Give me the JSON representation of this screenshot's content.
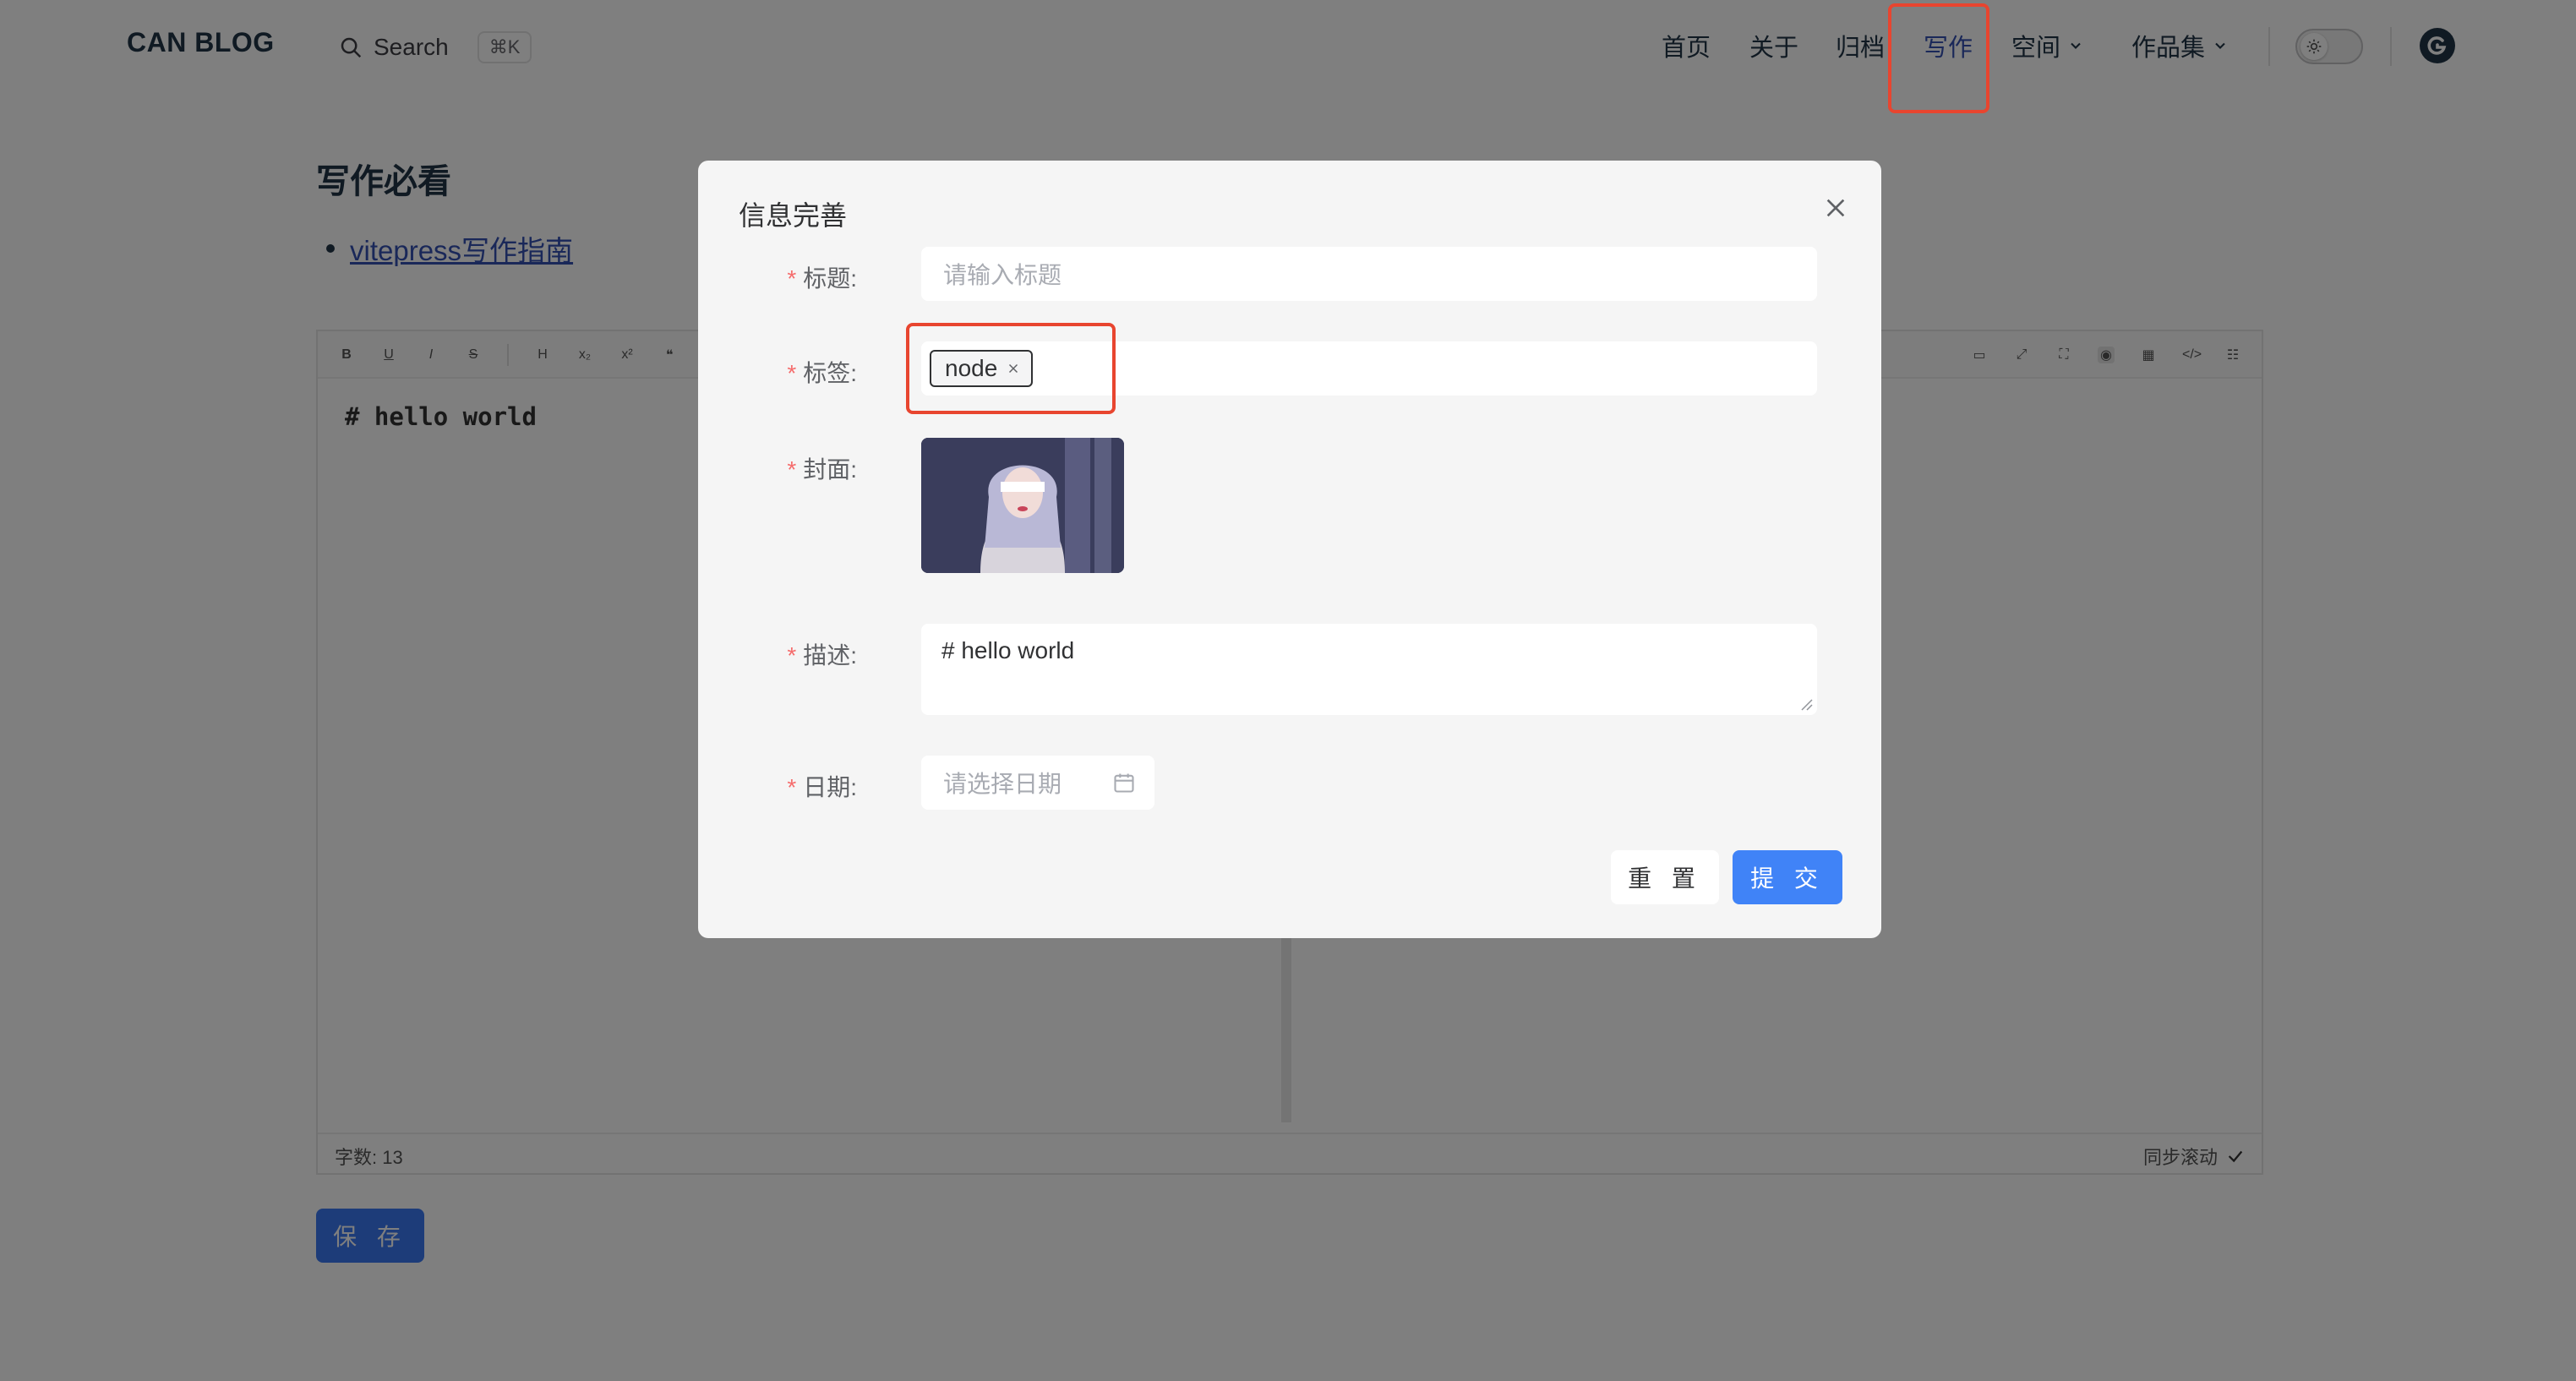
{
  "nav": {
    "logo": "CAN BLOG",
    "search_label": "Search",
    "search_shortcut": "⌘K",
    "items": [
      {
        "label": "首页"
      },
      {
        "label": "关于"
      },
      {
        "label": "归档"
      },
      {
        "label": "写作",
        "active": true
      },
      {
        "label": "空间",
        "dropdown": true
      },
      {
        "label": "作品集",
        "dropdown": true
      }
    ]
  },
  "page": {
    "title": "写作必看",
    "guide_link": "vitepress写作指南",
    "editor_content": "# hello world",
    "word_count": "字数: 13",
    "sync_scroll": "同步滚动",
    "save_label": "保 存",
    "toolbar_left": [
      "B",
      "U",
      "I",
      "S",
      "H",
      "x₂",
      "x²",
      "❝",
      "☰"
    ],
    "toolbar_right": [
      "▭",
      "⤢",
      "⛶",
      "◉",
      "▦",
      "</>",
      "☷"
    ]
  },
  "dialog": {
    "title": "信息完善",
    "fields": {
      "title": {
        "label": "标题:",
        "placeholder": "请输入标题"
      },
      "tags": {
        "label": "标签:",
        "tags": [
          "node"
        ]
      },
      "cover": {
        "label": "封面:"
      },
      "description": {
        "label": "描述:",
        "value": "# hello world"
      },
      "date": {
        "label": "日期:",
        "placeholder": "请选择日期"
      }
    },
    "reset_label": "重 置",
    "submit_label": "提 交"
  },
  "colors": {
    "accent": "#3451b2",
    "primary_button": "#4083f7",
    "required": "#f56c6c",
    "highlight": "#e8452f",
    "overlay": "rgba(0,0,0,0.5)"
  }
}
